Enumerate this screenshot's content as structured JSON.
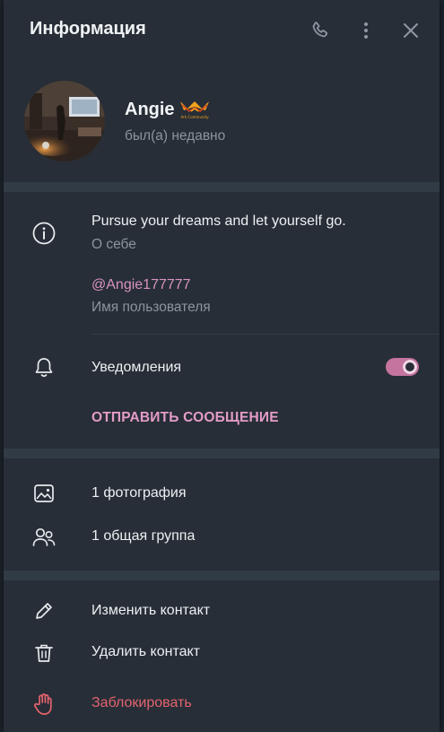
{
  "header": {
    "title": "Информация",
    "icons": [
      "phone-icon",
      "more-vertical-icon",
      "close-icon"
    ]
  },
  "profile": {
    "name": "Angie",
    "status": "был(а) недавно",
    "badge_text": "Ark Community"
  },
  "info": {
    "bio": "Pursue your dreams and let yourself go.",
    "bio_label": "О себе",
    "username": "@Angie177777",
    "username_label": "Имя пользователя"
  },
  "notifications": {
    "label": "Уведомления",
    "enabled": true
  },
  "send_message_label": "ОТПРАВИТЬ СООБЩЕНИЕ",
  "media": {
    "photos_label": "1 фотография",
    "groups_label": "1 общая группа"
  },
  "actions": {
    "edit_label": "Изменить контакт",
    "delete_label": "Удалить контакт",
    "block_label": "Заблокировать"
  },
  "colors": {
    "panel_bg": "#272e37",
    "accent": "#d993c1",
    "danger": "#e3636e",
    "muted": "#8b959e"
  }
}
